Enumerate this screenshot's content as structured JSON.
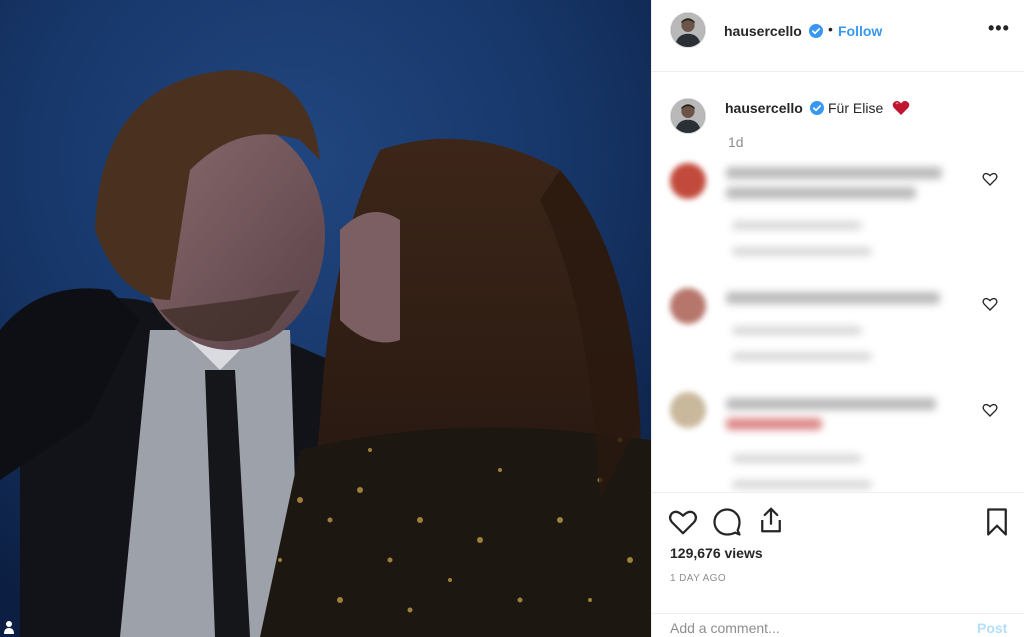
{
  "header": {
    "username": "hausercello",
    "separator": "•",
    "follow_label": "Follow",
    "more_label": "•••"
  },
  "caption": {
    "username": "hausercello",
    "text": "Für Elise",
    "emoji": "heart-emoji",
    "time_ago": "1d"
  },
  "blurred_comments": [
    {
      "avatar_color": "#c24a3c"
    },
    {
      "avatar_color": "#b7766c"
    },
    {
      "avatar_color": "#c9b89c"
    }
  ],
  "actions": {
    "views": "129,676 views",
    "posted": "1 DAY AGO"
  },
  "comment_box": {
    "placeholder": "Add a comment...",
    "post_label": "Post"
  },
  "colors": {
    "link_blue": "#3897f0",
    "post_disabled": "#b2dffc",
    "verified_blue": "#3897f0",
    "media_bg": "#163464"
  }
}
